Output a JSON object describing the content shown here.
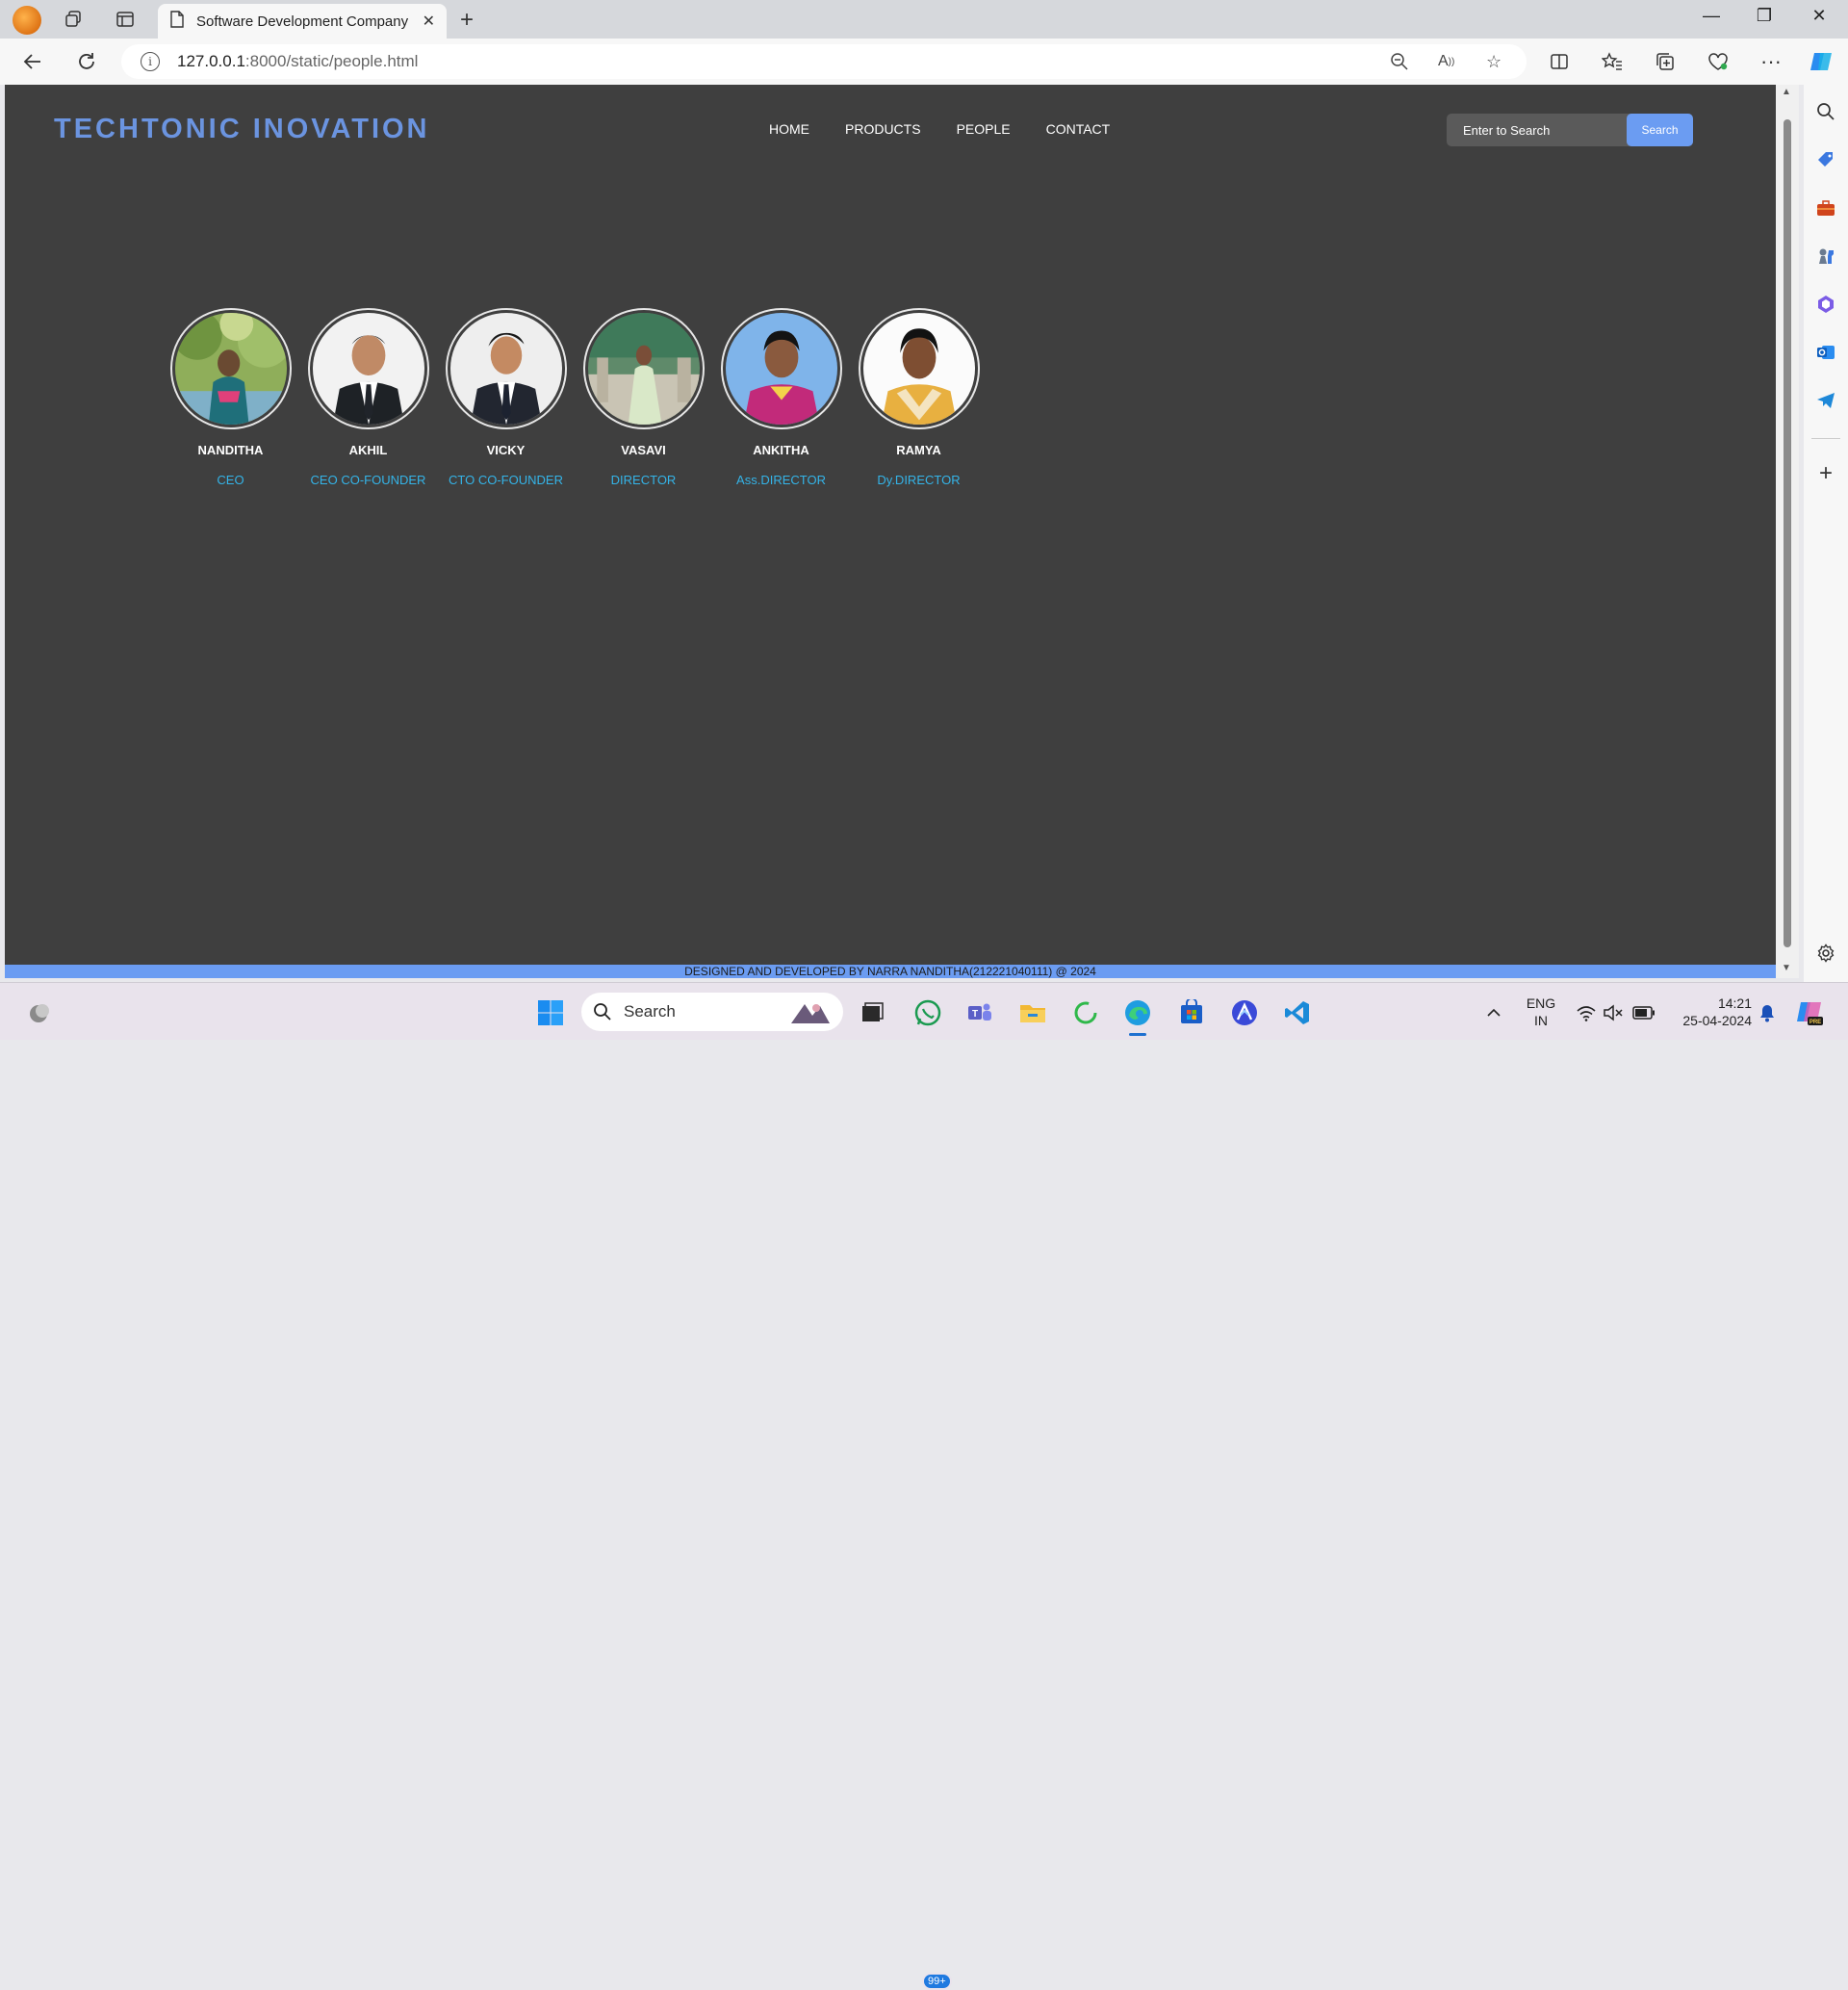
{
  "browser": {
    "tab_title": "Software Development Company",
    "url_host": "127.0.0.1",
    "url_rest": ":8000/static/people.html"
  },
  "site": {
    "brand": "TECHTONIC INOVATION",
    "nav": [
      "HOME",
      "PRODUCTS",
      "PEOPLE",
      "CONTACT"
    ],
    "search_placeholder": "Enter to Search",
    "search_button": "Search",
    "footer": "DESIGNED AND DEVELOPED BY NARRA NANDITHA(212221040111) @ 2024"
  },
  "people": [
    {
      "name": "NANDITHA",
      "role": "CEO",
      "photo": "outdoor-portrait-trees"
    },
    {
      "name": "AKHIL",
      "role": "CEO CO-FOUNDER",
      "photo": "suit-portrait"
    },
    {
      "name": "VICKY",
      "role": "CTO CO-FOUNDER",
      "photo": "suit-portrait"
    },
    {
      "name": "VASAVI",
      "role": "DIRECTOR",
      "photo": "outdoor-portrait-green-dress"
    },
    {
      "name": "ANKITHA",
      "role": "Ass.DIRECTOR",
      "photo": "blue-background-portrait"
    },
    {
      "name": "RAMYA",
      "role": "Dy.DIRECTOR",
      "photo": "white-background-portrait"
    }
  ],
  "taskbar": {
    "search_label": "Search",
    "whatsapp_badge": "99+",
    "lang_line1": "ENG",
    "lang_line2": "IN",
    "time": "14:21",
    "date": "25-04-2024"
  },
  "colors": {
    "page_bg": "#3f3f3f",
    "brand": "#6b94e0",
    "accent": "#6b9cf2",
    "role_text": "#34b4e8"
  }
}
